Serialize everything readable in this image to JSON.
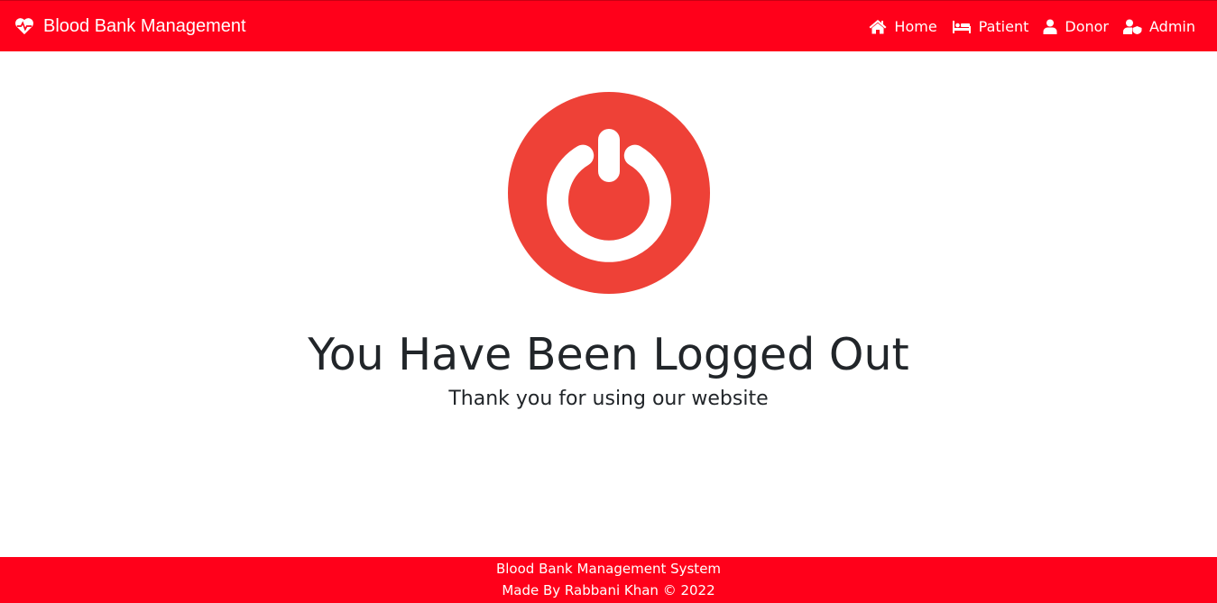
{
  "navbar": {
    "brand": {
      "icon": "heartbeat-icon",
      "label": "Blood Bank Management"
    },
    "links": [
      {
        "icon": "home-icon",
        "label": "Home"
      },
      {
        "icon": "bed-icon",
        "label": "Patient"
      },
      {
        "icon": "user-icon",
        "label": "Donor"
      },
      {
        "icon": "user-shield-icon",
        "label": "Admin"
      }
    ],
    "background": "#ff001a"
  },
  "main": {
    "icon": "power-icon",
    "icon_color": "#ee4137",
    "title": "You Have Been Logged Out",
    "subtitle": "Thank you for using our website"
  },
  "footer": {
    "line1": "Blood Bank Management System",
    "line2": "Made By Rabbani Khan © 2022"
  }
}
